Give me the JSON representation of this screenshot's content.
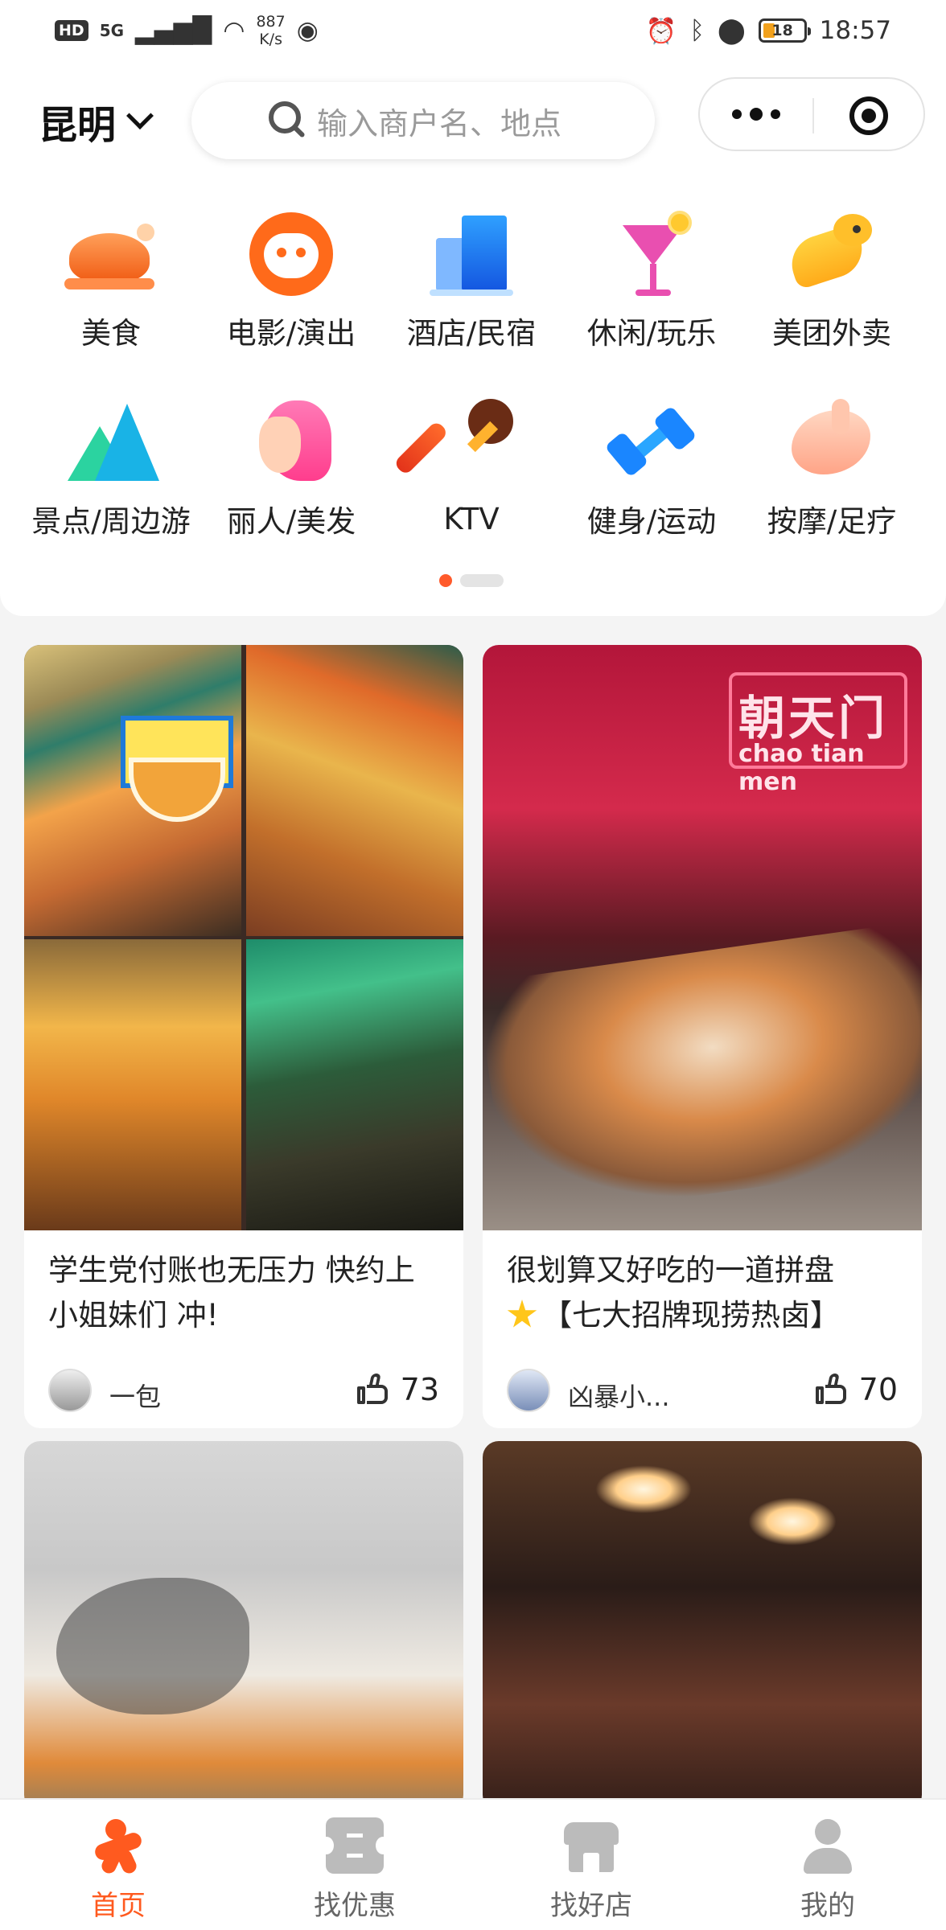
{
  "status_bar": {
    "hd": "HD",
    "network": "5G",
    "speed_value": "887",
    "speed_unit": "K/s",
    "battery": "18",
    "time": "18:57",
    "icons": [
      "signal-icon",
      "wifi-icon",
      "eye-icon",
      "alarm-icon",
      "bluetooth-icon",
      "location-icon",
      "battery-icon"
    ]
  },
  "header": {
    "city": "昆明",
    "search_placeholder": "输入商户名、地点"
  },
  "categories": [
    {
      "label": "美食",
      "icon": "roast-chicken-icon"
    },
    {
      "label": "电影/演出",
      "icon": "cat-face-icon"
    },
    {
      "label": "酒店/民宿",
      "icon": "building-icon"
    },
    {
      "label": "休闲/玩乐",
      "icon": "cocktail-icon"
    },
    {
      "label": "美团外卖",
      "icon": "kangaroo-icon"
    },
    {
      "label": "景点/周边游",
      "icon": "mountain-icon"
    },
    {
      "label": "丽人/美发",
      "icon": "woman-head-icon"
    },
    {
      "label": "KTV",
      "icon": "microphone-icon"
    },
    {
      "label": "健身/运动",
      "icon": "dumbbell-icon"
    },
    {
      "label": "按摩/足疗",
      "icon": "massage-hand-icon"
    }
  ],
  "pager": {
    "current": 1,
    "total": 2
  },
  "feed": [
    {
      "title": "学生党付账也无压力 快约上小姐妹们 冲!",
      "author": "一包",
      "likes": "73"
    },
    {
      "title_prefix_icon": "star-icon",
      "title": "很划算又好吃的一道拼盘【七大招牌现捞热卤】",
      "title_line1": "很划算又好吃的一道拼盘",
      "title_line2": "【七大招牌现捞热卤】",
      "author": "凶暴小...",
      "likes": "70",
      "photo_sign": "朝天门",
      "photo_sign_sub": "chao tian men"
    },
    {
      "title": "",
      "author": "",
      "likes": ""
    },
    {
      "title": "",
      "author": "",
      "likes": ""
    }
  ],
  "tabbar": [
    {
      "label": "首页",
      "active": true
    },
    {
      "label": "找优惠",
      "active": false
    },
    {
      "label": "找好店",
      "active": false
    },
    {
      "label": "我的",
      "active": false
    }
  ],
  "colors": {
    "accent": "#ff5a1f",
    "inactive": "#bbbbbb",
    "background": "#f4f4f4"
  }
}
